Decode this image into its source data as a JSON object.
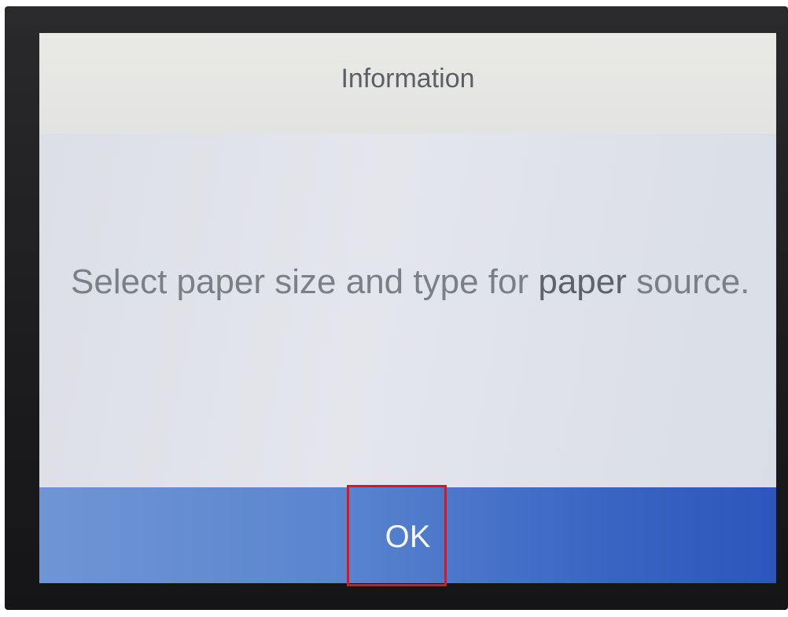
{
  "dialog": {
    "title": "Information",
    "message_part1": "Select paper size and type for ",
    "message_part2": "paper",
    "message_part3": " source.",
    "ok_label": "OK"
  },
  "colors": {
    "title_bar": "#e6e6e4",
    "message_background": "#dfe2e8",
    "footer_left": "#6f95d4",
    "footer_right": "#2c56bb",
    "highlight": "#e0141e",
    "text": "#7b7f88"
  }
}
